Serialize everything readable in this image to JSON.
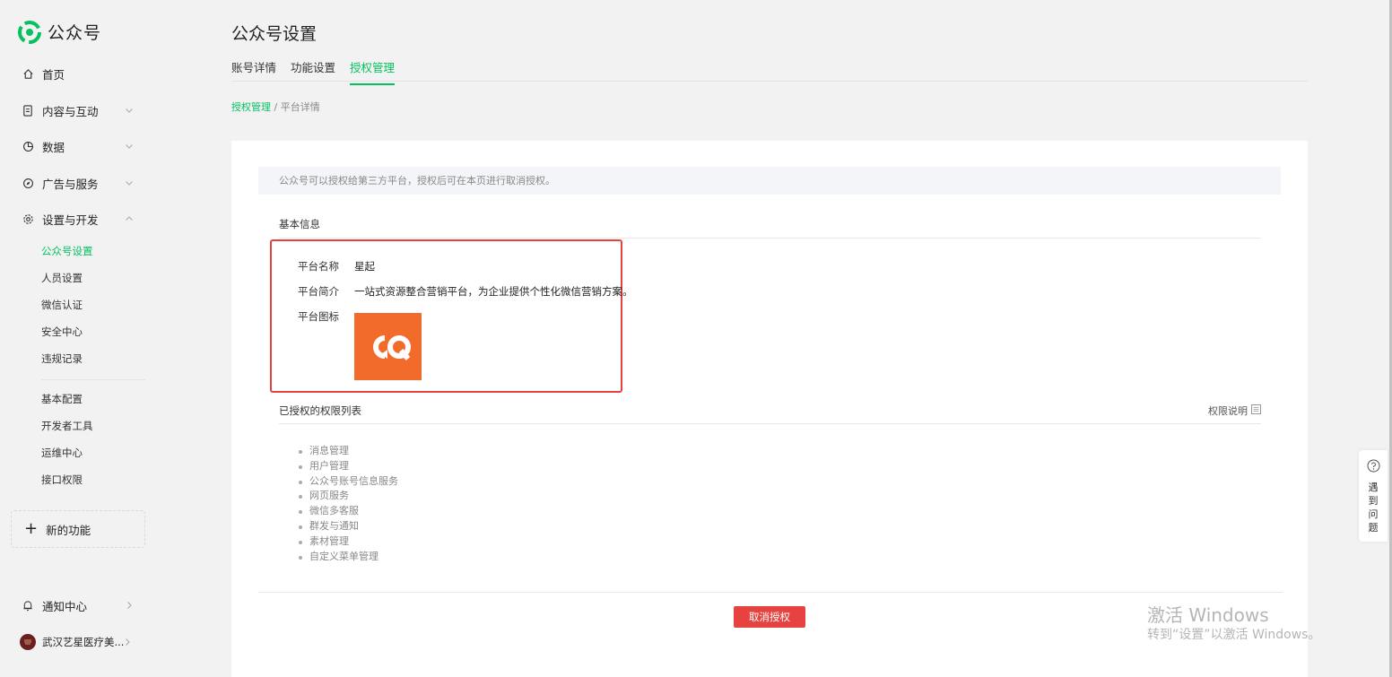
{
  "app": {
    "name": "公众号"
  },
  "sidebar": {
    "nav": [
      {
        "label": "首页"
      },
      {
        "label": "内容与互动"
      },
      {
        "label": "数据"
      },
      {
        "label": "广告与服务"
      },
      {
        "label": "设置与开发"
      }
    ],
    "settings_items": [
      {
        "label": "公众号设置"
      },
      {
        "label": "人员设置"
      },
      {
        "label": "微信认证"
      },
      {
        "label": "安全中心"
      },
      {
        "label": "违规记录"
      }
    ],
    "dev_items": [
      {
        "label": "基本配置"
      },
      {
        "label": "开发者工具"
      },
      {
        "label": "运维中心"
      },
      {
        "label": "接口权限"
      }
    ],
    "new_feature": "新的功能",
    "notification": "通知中心",
    "account": "武汉艺星医疗美..."
  },
  "page": {
    "title": "公众号设置",
    "tabs": [
      {
        "label": "账号详情"
      },
      {
        "label": "功能设置"
      },
      {
        "label": "授权管理"
      }
    ],
    "breadcrumb": {
      "link": "授权管理",
      "sep": " / ",
      "current": "平台详情"
    }
  },
  "card": {
    "notice": "公众号可以授权给第三方平台，授权后可在本页进行取消授权。",
    "basic_title": "基本信息",
    "platform": {
      "name_label": "平台名称",
      "name": "星起",
      "desc_label": "平台简介",
      "desc": "一站式资源整合营销平台，为企业提供个性化微信营销方案。",
      "icon_label": "平台图标",
      "icon_color": "#f26b2a"
    },
    "perm_title": "已授权的权限列表",
    "perm_link": "权限说明",
    "permissions": [
      "消息管理",
      "用户管理",
      "公众号账号信息服务",
      "网页服务",
      "微信多客服",
      "群发与通知",
      "素材管理",
      "自定义菜单管理"
    ],
    "revoke_button": "取消授权"
  },
  "help": {
    "label": "遇到问题"
  },
  "watermark": {
    "title": "激活 Windows",
    "subtitle": "转到“设置”以激活 Windows。"
  },
  "colors": {
    "accent": "#07c160",
    "danger": "#e64340"
  }
}
